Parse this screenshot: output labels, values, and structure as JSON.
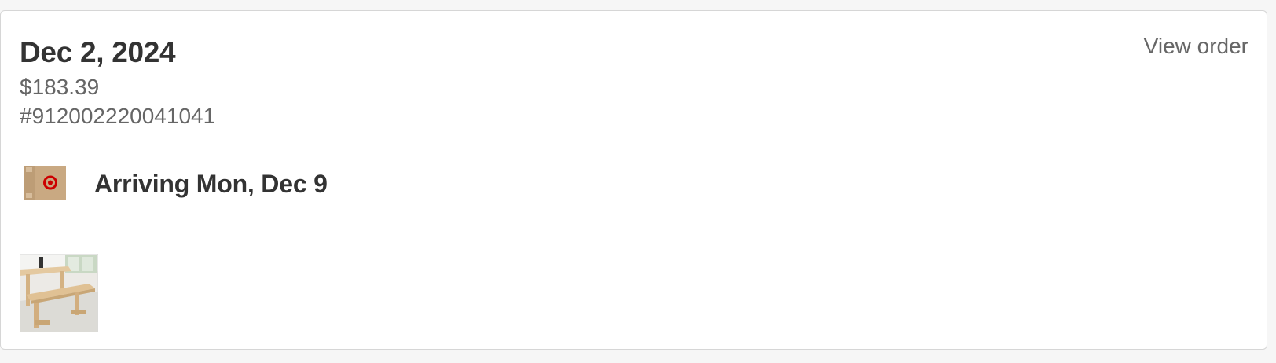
{
  "order": {
    "date": "Dec 2, 2024",
    "total": "$183.39",
    "number": "#912002220041041",
    "view_order_label": "View order"
  },
  "shipment": {
    "status": "Arriving Mon, Dec 9",
    "icon": "package-box-icon"
  },
  "items": [
    {
      "image": "dining-table-bench-thumbnail"
    }
  ],
  "colors": {
    "heading": "#333333",
    "secondary_text": "#666666",
    "box_tan": "#c9a982",
    "target_red": "#cc0000"
  }
}
